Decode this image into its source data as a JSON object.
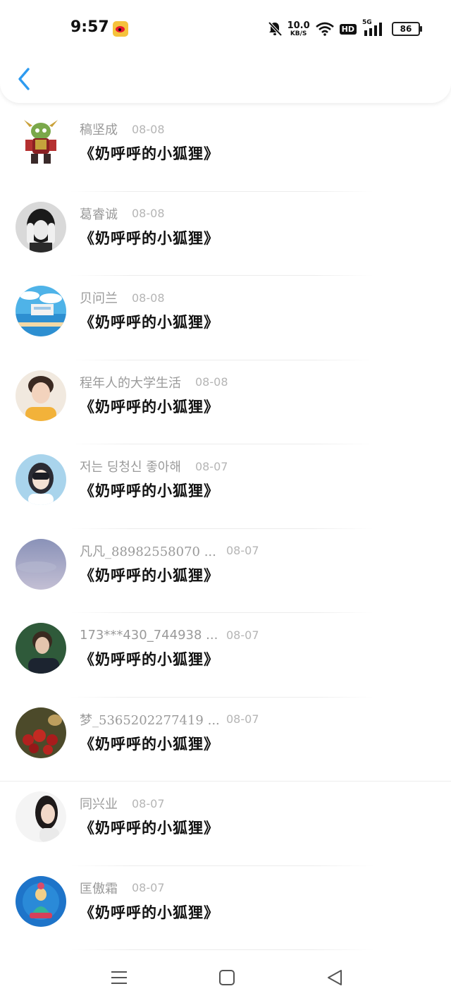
{
  "status_bar": {
    "time": "9:57",
    "net_speed_value": "10.0",
    "net_speed_unit": "KB/S",
    "hd": "HD",
    "network": "5G",
    "battery": "86"
  },
  "header": {
    "back_icon": "chevron-left-icon"
  },
  "colors": {
    "accent": "#2e9bf0",
    "username": "#9a9a9a",
    "date": "#b5b5b5",
    "comment": "#111111"
  },
  "list": [
    {
      "username": "稿坚成",
      "date": "08-08",
      "comment": "《奶呼呼的小狐狸》"
    },
    {
      "username": "葛睿诚",
      "date": "08-08",
      "comment": "《奶呼呼的小狐狸》"
    },
    {
      "username": "贝问兰",
      "date": "08-08",
      "comment": "《奶呼呼的小狐狸》"
    },
    {
      "username": "程年人的大学生活",
      "date": "08-08",
      "comment": "《奶呼呼的小狐狸》"
    },
    {
      "username": "저는 딩청신 좋아해",
      "date": "08-07",
      "comment": "《奶呼呼的小狐狸》"
    },
    {
      "username": "凡凡_88982558070 ...",
      "date": "08-07",
      "comment": "《奶呼呼的小狐狸》"
    },
    {
      "username": "173***430_744938 ...",
      "date": "08-07",
      "comment": "《奶呼呼的小狐狸》"
    },
    {
      "username": "梦_5365202277419 ...",
      "date": "08-07",
      "comment": "《奶呼呼的小狐狸》"
    },
    {
      "username": "同兴业",
      "date": "08-07",
      "comment": "《奶呼呼的小狐狸》"
    },
    {
      "username": "匡傲霜",
      "date": "08-07",
      "comment": "《奶呼呼的小狐狸》"
    }
  ],
  "bottom_nav": {
    "menu_icon": "menu-icon",
    "home_icon": "home-square-icon",
    "back_icon": "back-triangle-icon"
  }
}
